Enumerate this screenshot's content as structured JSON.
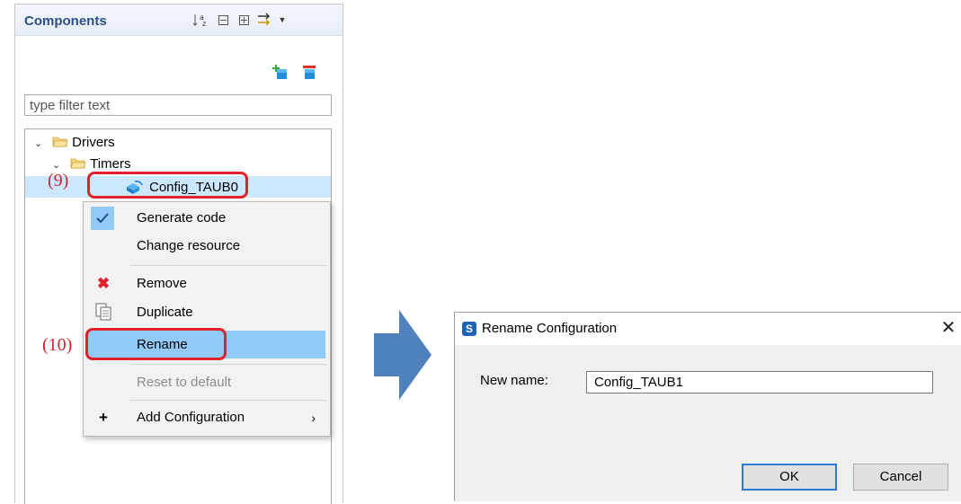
{
  "panel": {
    "title": "Components",
    "filter_placeholder": "type filter text",
    "toolbar_icons": [
      "sort-az-icon",
      "collapse-all-icon",
      "expand-all-icon",
      "filter-arrows-icon",
      "view-menu-icon"
    ],
    "add_icon": "add-component-icon",
    "remove_icon": "remove-component-icon"
  },
  "tree": {
    "drivers": "Drivers",
    "timers": "Timers",
    "config": "Config_TAUB0"
  },
  "menu": {
    "generate_code": "Generate code",
    "change_resource": "Change resource",
    "remove": "Remove",
    "duplicate": "Duplicate",
    "rename": "Rename",
    "reset_to_default": "Reset to default",
    "add_configuration": "Add Configuration"
  },
  "callouts": {
    "step9": "(9)",
    "step10": "(10)"
  },
  "dialog": {
    "title": "Rename Configuration",
    "label": "New name:",
    "value": "Config_TAUB1",
    "ok": "OK",
    "cancel": "Cancel"
  },
  "colors": {
    "selection": "#cce8ff",
    "menu_highlight": "#91c9f7",
    "callout": "#e0202a",
    "arrow": "#4f81bd"
  }
}
